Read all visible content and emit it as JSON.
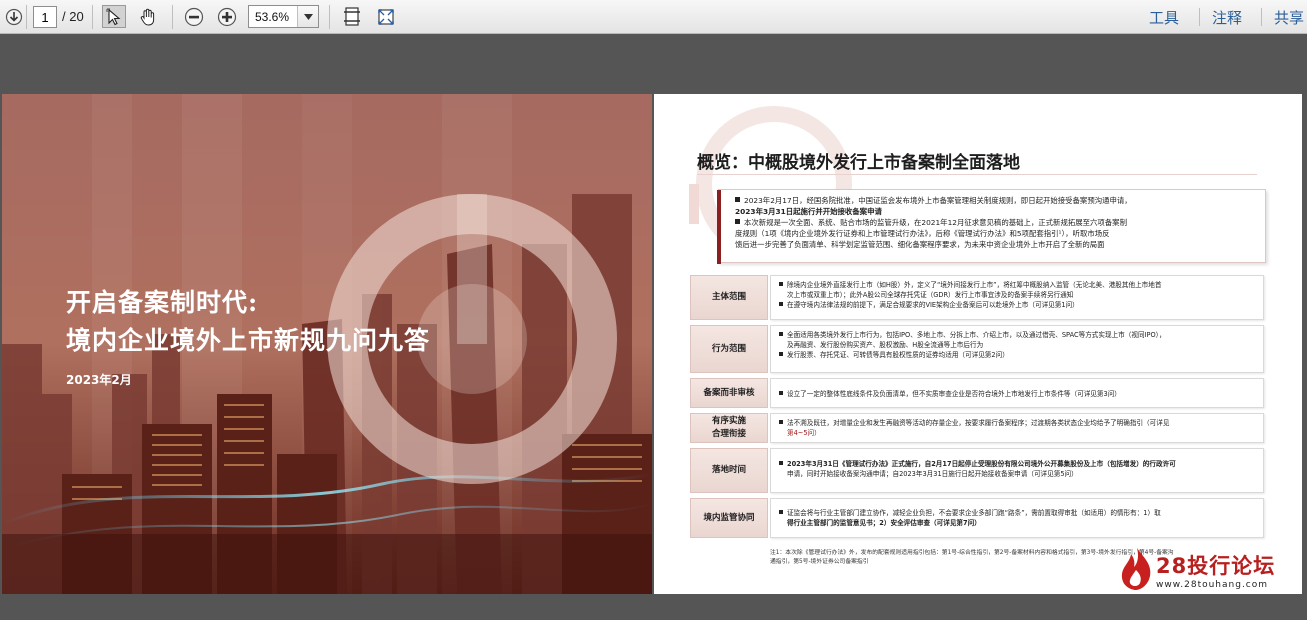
{
  "toolbar": {
    "page_current": "1",
    "page_total": "/ 20",
    "zoom": "53.6%",
    "links": [
      "工具",
      "注释",
      "共享"
    ]
  },
  "cover": {
    "title_line1": "开启备案制时代:",
    "title_line2": "境内企业境外上市新规九问九答",
    "date": "2023年2月"
  },
  "slide": {
    "title": "概览：中概股境外发行上市备案制全面落地",
    "intro": [
      "2023年2月17日，经国务院批准，中国证监会发布境外上市备案管理相关制度规则，即日起开始接受备案预沟通申请，",
      "2023年3月31日起施行并开始接收备案申请",
      "本次新规是一次全面、系统、贴合市场的监管升级，在2021年12月征求意见稿的基础上，正式新规拓展至六项备案制",
      "度规则（1项《境内企业境外发行证券和上市管理试行办法》，后称《管理试行办法》和5项配套指引¹），听取市场反",
      "馈后进一步完善了负面清单、科学划定监管范围、细化备案程序要求，为未来中资企业境外上市开启了全新的局面"
    ],
    "rows": [
      {
        "label": "主体范围",
        "lines": [
          "除境内企业境外直接发行上市（如H股）外，定义了“境外间接发行上市”，将红筹中概股纳入监管（无论北美、港股其他上市地首",
          "次上市或双重上市）；此外A股公司全球存托凭证（GDR）发行上市事宜涉及的备案手续将另行通知",
          "在遵守境内法律法规的前提下，满足合规要求的VIE架构企业备案后可以赴境外上市（可详见第1问）"
        ]
      },
      {
        "label": "行为范围",
        "lines": [
          "全面适用各类境外发行上市行为，包括IPO、多地上市、分拆上市、介绍上市，以及通过借壳、SPAC等方式实现上市（视同IPO），",
          "及再融资、发行股份购买资产、股权激励、H股全流通等上市后行为",
          "发行股票、存托凭证、可转债等具有股权性质的证券均适用（可详见第2问）"
        ]
      },
      {
        "label": "备案而非审核",
        "lines": [
          "设立了一定的整体性底线条件及负面清单，但不实质审查企业是否符合境外上市地发行上市条件等（可详见第3问）"
        ]
      },
      {
        "label": "有序实施\n合理衔接",
        "lines": [
          "法不溯及既往，对增量企业和发生再融资等活动的存量企业，按要求履行备案程序；过渡期各类状态企业均给予了明确指引（可详见",
          "第4~5问）"
        ]
      },
      {
        "label": "落地时间",
        "lines": [
          "2023年3月31日《管理试行办法》正式施行，自2月17日起停止受理股份有限公司境外公开募集股份及上市（包括增发）的行政许可",
          "申请，同时开始接收备案沟通申请；自2023年3月31日施行日起开始接收备案申请（可详见第5问）"
        ]
      },
      {
        "label": "境内监管协同",
        "lines": [
          "证监会将与行业主管部门建立协作，减轻企业负担，不会要求企业多部门跑“路条”，需前置取得审批（如适用）的情形有：1）取",
          "得行业主管部门的监管意见书；2）安全评估审查（可详见第7问）"
        ]
      }
    ],
    "footnote_lines": [
      "注1：本次除《管理试行办法》外，发布的配套规则适用指引包括：第1号-综合性指引，第2号-备案材料内容和格式指引，第3号-境外发行指引，第4号-备案沟",
      "通指引，第5号-境外证券公司备案指引"
    ]
  },
  "watermark": {
    "brand": "28投行论坛",
    "url": "www.28touhang.com"
  },
  "colors": {
    "accent": "#8b1e1e",
    "link": "#2b5f99",
    "viewer_bg": "#555555"
  }
}
